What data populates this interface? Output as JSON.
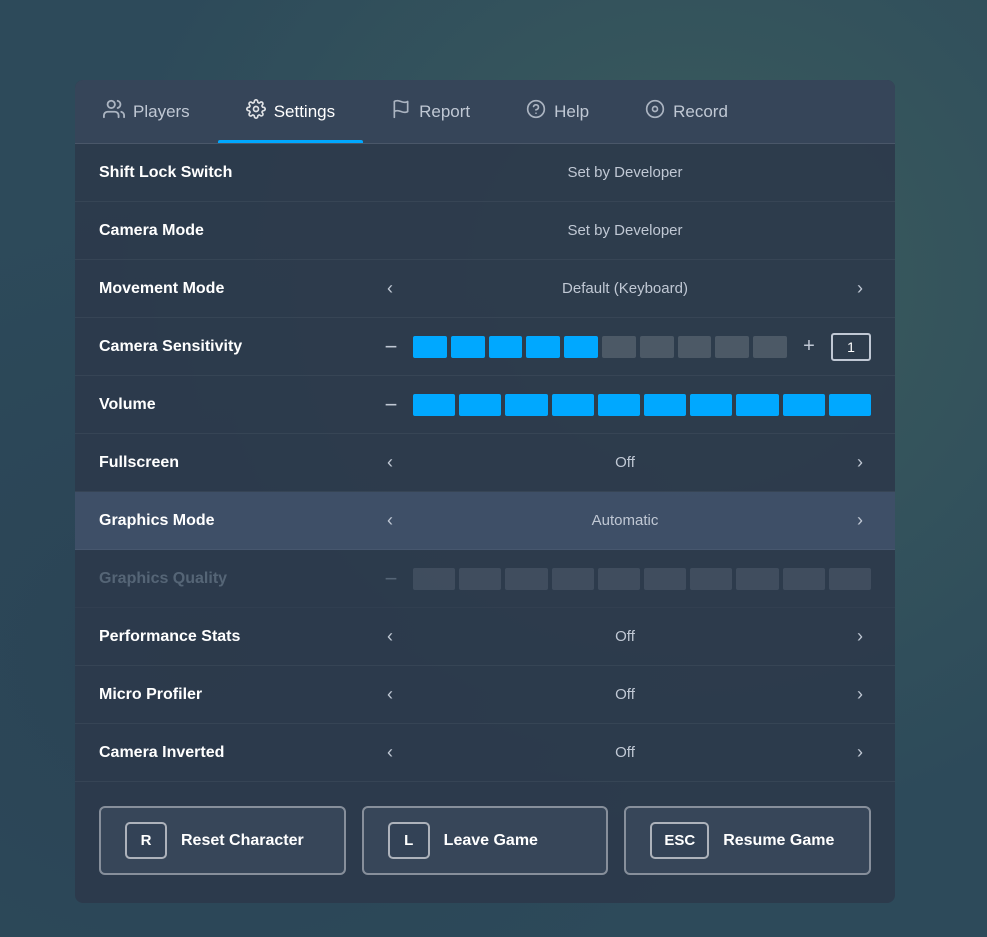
{
  "tabs": [
    {
      "id": "players",
      "label": "Players",
      "icon": "👥",
      "active": false
    },
    {
      "id": "settings",
      "label": "Settings",
      "icon": "⚙️",
      "active": true
    },
    {
      "id": "report",
      "label": "Report",
      "icon": "🚩",
      "active": false
    },
    {
      "id": "help",
      "label": "Help",
      "icon": "❓",
      "active": false
    },
    {
      "id": "record",
      "label": "Record",
      "icon": "⏺",
      "active": false
    }
  ],
  "settings": [
    {
      "id": "shift-lock",
      "label": "Shift Lock Switch",
      "type": "static",
      "value": "Set by Developer",
      "disabled": false,
      "highlighted": false
    },
    {
      "id": "camera-mode",
      "label": "Camera Mode",
      "type": "static",
      "value": "Set by Developer",
      "disabled": false,
      "highlighted": false
    },
    {
      "id": "movement-mode",
      "label": "Movement Mode",
      "type": "arrow",
      "value": "Default (Keyboard)",
      "disabled": false,
      "highlighted": false
    },
    {
      "id": "camera-sensitivity",
      "label": "Camera Sensitivity",
      "type": "slider",
      "filled": 5,
      "total": 10,
      "valuebox": "1",
      "disabled": false,
      "highlighted": false
    },
    {
      "id": "volume",
      "label": "Volume",
      "type": "slider-full",
      "filled": 10,
      "total": 10,
      "disabled": false,
      "highlighted": false
    },
    {
      "id": "fullscreen",
      "label": "Fullscreen",
      "type": "arrow",
      "value": "Off",
      "disabled": false,
      "highlighted": false
    },
    {
      "id": "graphics-mode",
      "label": "Graphics Mode",
      "type": "arrow",
      "value": "Automatic",
      "disabled": false,
      "highlighted": true
    },
    {
      "id": "graphics-quality",
      "label": "Graphics Quality",
      "type": "slider-disabled",
      "filled": 0,
      "total": 10,
      "disabled": true,
      "highlighted": false
    },
    {
      "id": "performance-stats",
      "label": "Performance Stats",
      "type": "arrow",
      "value": "Off",
      "disabled": false,
      "highlighted": false
    },
    {
      "id": "micro-profiler",
      "label": "Micro Profiler",
      "type": "arrow",
      "value": "Off",
      "disabled": false,
      "highlighted": false
    },
    {
      "id": "camera-inverted",
      "label": "Camera Inverted",
      "type": "arrow",
      "value": "Off",
      "disabled": false,
      "highlighted": false
    }
  ],
  "buttons": [
    {
      "id": "reset",
      "key": "R",
      "label": "Reset Character"
    },
    {
      "id": "leave",
      "key": "L",
      "label": "Leave Game"
    },
    {
      "id": "resume",
      "key": "ESC",
      "label": "Resume Game"
    }
  ]
}
